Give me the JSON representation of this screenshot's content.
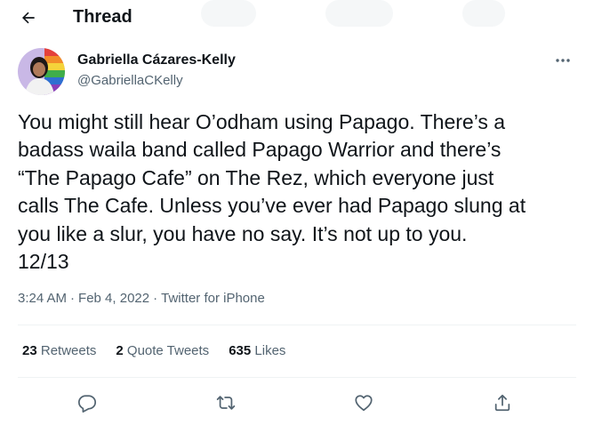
{
  "header": {
    "title": "Thread"
  },
  "author": {
    "name": "Gabriella Cázares-Kelly",
    "handle": "@GabriellaCKelly"
  },
  "tweet": {
    "lines": [
      "You might still hear O’odham using Papago. There’s a",
      "badass waila band called Papago Warrior and there’s",
      "“The Papago Cafe” on The Rez, which everyone just",
      "calls The Cafe. Unless you’ve ever had Papago slung at",
      "you like a slur, you have no say. It’s not up to you.",
      "12/13"
    ],
    "time": "3:24 AM",
    "date": "Feb 4, 2022",
    "source": "Twitter for iPhone",
    "separator": "·"
  },
  "stats": {
    "retweets_count": "23",
    "retweets_label": "Retweets",
    "quotes_count": "2",
    "quotes_label": "Quote Tweets",
    "likes_count": "635",
    "likes_label": "Likes"
  },
  "icons": {
    "back": "arrow-left-icon",
    "more": "more-horizontal-icon",
    "reply": "reply-icon",
    "retweet": "retweet-icon",
    "like": "heart-icon",
    "share": "share-icon"
  },
  "colors": {
    "text_primary": "#0f1419",
    "text_secondary": "#536471",
    "divider": "#eff3f4"
  }
}
